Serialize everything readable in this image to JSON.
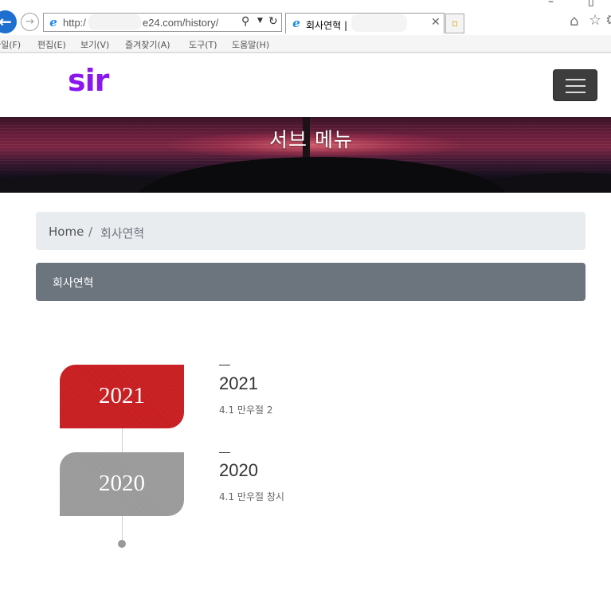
{
  "browser": {
    "address_prefix": "http:/",
    "address_domain": "e24.com/history/",
    "tab_title": "회사연혁 |",
    "menu": [
      "파일(F)",
      "편집(E)",
      "보기(V)",
      "즐겨찾기(A)",
      "도구(T)",
      "도움말(H)"
    ],
    "icons": [
      "back-arrow-icon",
      "forward-arrow-icon",
      "ie-icon",
      "search-icon",
      "refresh-icon",
      "close-icon",
      "new-tab-icon",
      "home-icon",
      "star-icon",
      "gear-icon"
    ]
  },
  "site": {
    "logo_text": "sir",
    "logo_color": "#8a17f0",
    "banner_title": "서브 메뉴"
  },
  "breadcrumb": {
    "home": "Home",
    "separator": "/",
    "current": "회사연혁"
  },
  "section": {
    "title": "회사연혁",
    "bar_color": "#6c757d"
  },
  "timeline": [
    {
      "badge": "2021",
      "year": "2021",
      "event": "4.1 만우절 2",
      "color": "#c71d20"
    },
    {
      "badge": "2020",
      "year": "2020",
      "event": "4.1 만우절 창시",
      "color": "#999999"
    }
  ]
}
